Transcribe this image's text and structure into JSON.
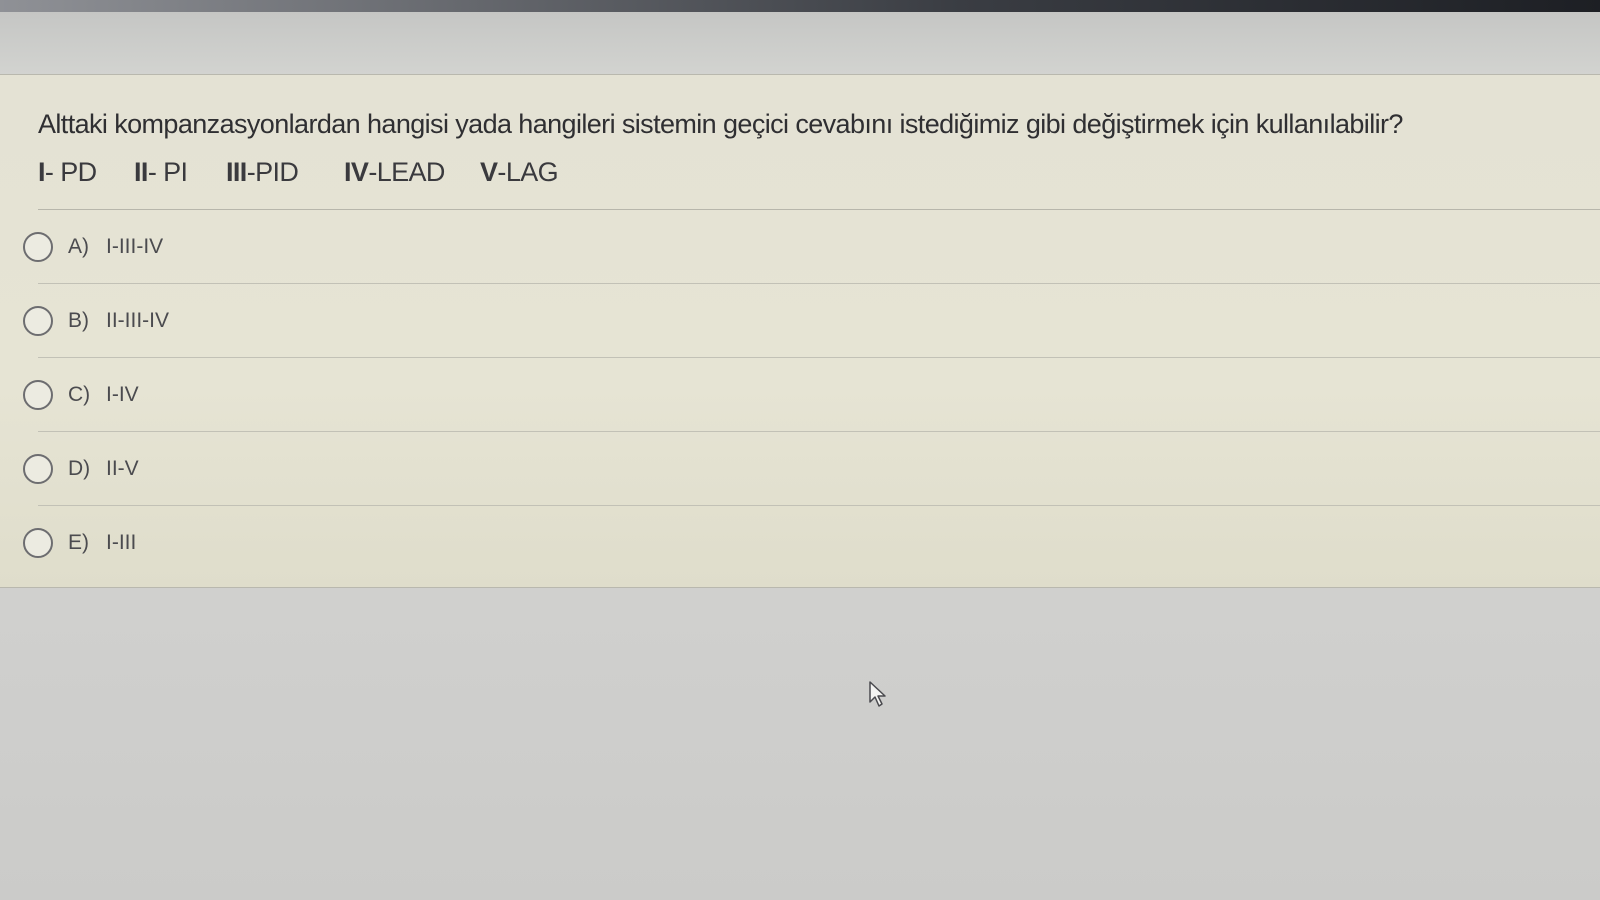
{
  "question": {
    "text": "Alttaki kompanzasyonlardan hangisi yada hangileri sistemin geçici cevabını istediğimiz gibi değiştirmek için kullanılabilir?",
    "legend": [
      {
        "numeral": "I",
        "label": "- PD"
      },
      {
        "numeral": "II",
        "label": "- PI"
      },
      {
        "numeral": "III",
        "label": "-PID"
      },
      {
        "numeral": "IV",
        "label": "-LEAD"
      },
      {
        "numeral": "V",
        "label": "-LAG"
      }
    ]
  },
  "answers": [
    {
      "letter": "A)",
      "text": "I-III-IV"
    },
    {
      "letter": "B)",
      "text": "II-III-IV"
    },
    {
      "letter": "C)",
      "text": "I-IV"
    },
    {
      "letter": "D)",
      "text": "II-V"
    },
    {
      "letter": "E)",
      "text": "I-III"
    }
  ],
  "icons": {
    "cursor": "mouse-pointer-icon"
  }
}
